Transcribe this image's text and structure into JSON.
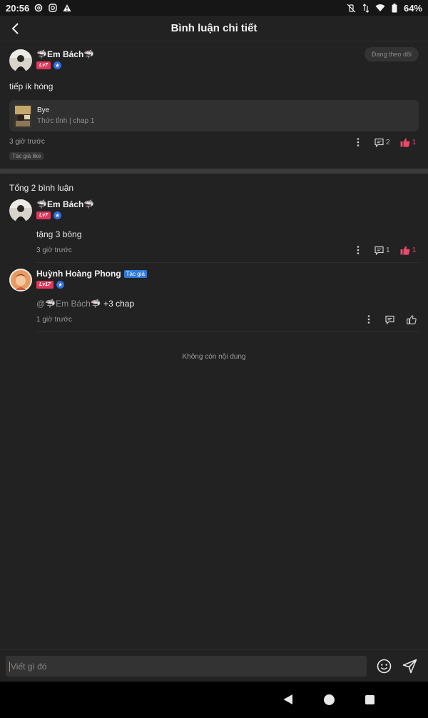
{
  "status": {
    "time": "20:56",
    "battery": "64%"
  },
  "appbar": {
    "title": "Bình luận chi tiết"
  },
  "post": {
    "author": "🦈Em Bách🦈",
    "level": "Lv7",
    "follow_label": "Đang theo dõi",
    "text": "tiếp ik hóng",
    "chapter_title": "Bye",
    "chapter_sub": "Thức tỉnh | chap 1",
    "time": "3 giờ trước",
    "tag": "Tác giả like",
    "reply_count": "2",
    "like_count": "1"
  },
  "total_label": "Tổng 2 bình luận",
  "comments": [
    {
      "author": "🦈Em Bách🦈",
      "level": "Lv7",
      "text": "tặng 3 bông",
      "time": "3 giờ trước",
      "reply_count": "1",
      "like_count": "1"
    },
    {
      "author": "Huỳnh Hoàng Phong",
      "author_tag": "Tác giả",
      "level": "Lv17",
      "mention": "@🦈Em Bách🦈",
      "text": "+3 chap",
      "time": "1 giờ trước"
    }
  ],
  "end_label": "Không còn nội dung",
  "input": {
    "placeholder": "Viết gì đó"
  },
  "colors": {
    "background": "#222223",
    "like_active": "#e94b6a",
    "level_badge": "#e0375a",
    "author_tag": "#2f7ad8"
  }
}
